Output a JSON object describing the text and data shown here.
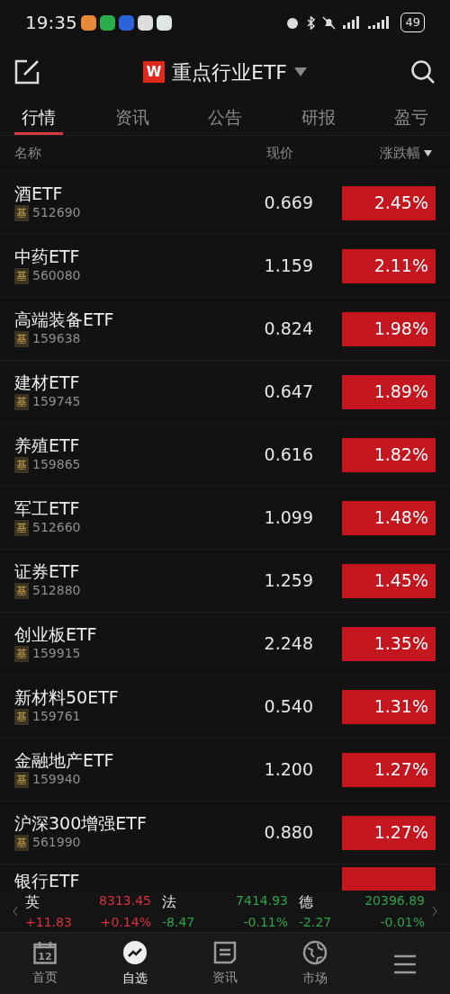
{
  "status_bar": {
    "time": "19:35",
    "battery": "49"
  },
  "header": {
    "title": "重点行业ETF",
    "logo": "W"
  },
  "tabs": [
    {
      "label": "行情",
      "selected": true
    },
    {
      "label": "资讯",
      "selected": false
    },
    {
      "label": "公告",
      "selected": false
    },
    {
      "label": "研报",
      "selected": false
    },
    {
      "label": "盈亏",
      "selected": false
    }
  ],
  "table": {
    "columns": [
      "名称",
      "现价",
      "涨跌幅"
    ],
    "rows": [
      {
        "name": "酒ETF",
        "tag": "基",
        "code": "512690",
        "price": "0.669",
        "change": "2.45%",
        "color": "#c3161f"
      },
      {
        "name": "中药ETF",
        "tag": "基",
        "code": "560080",
        "price": "1.159",
        "change": "2.11%",
        "color": "#c3161f"
      },
      {
        "name": "高端装备ETF",
        "tag": "基",
        "code": "159638",
        "price": "0.824",
        "change": "1.98%",
        "color": "#c3161f"
      },
      {
        "name": "建材ETF",
        "tag": "基",
        "code": "159745",
        "price": "0.647",
        "change": "1.89%",
        "color": "#c3161f"
      },
      {
        "name": "养殖ETF",
        "tag": "基",
        "code": "159865",
        "price": "0.616",
        "change": "1.82%",
        "color": "#c3161f"
      },
      {
        "name": "军工ETF",
        "tag": "基",
        "code": "512660",
        "price": "1.099",
        "change": "1.48%",
        "color": "#c3161f"
      },
      {
        "name": "证券ETF",
        "tag": "基",
        "code": "512880",
        "price": "1.259",
        "change": "1.45%",
        "color": "#c3161f"
      },
      {
        "name": "创业板ETF",
        "tag": "基",
        "code": "159915",
        "price": "2.248",
        "change": "1.35%",
        "color": "#c3161f"
      },
      {
        "name": "新材料50ETF",
        "tag": "基",
        "code": "159761",
        "price": "0.540",
        "change": "1.31%",
        "color": "#c3161f"
      },
      {
        "name": "金融地产ETF",
        "tag": "基",
        "code": "159940",
        "price": "1.200",
        "change": "1.27%",
        "color": "#c3161f"
      },
      {
        "name": "沪深300增强ETF",
        "tag": "基",
        "code": "561990",
        "price": "0.880",
        "change": "1.27%",
        "color": "#c3161f"
      },
      {
        "name": "银行ETF",
        "color": "#c3161f",
        "partial": true
      }
    ]
  },
  "ticker": [
    {
      "name": "英",
      "price": "8313.45",
      "change": "+11.83",
      "pct": "+0.14%",
      "color": "#d8323a"
    },
    {
      "name": "法",
      "price": "7414.93",
      "change": "-8.47",
      "pct": "-0.11%",
      "color": "#2fa24a"
    },
    {
      "name": "德",
      "price": "20396.89",
      "change": "-2.27",
      "pct": "-0.01%",
      "color": "#2fa24a"
    }
  ],
  "nav": [
    {
      "label": "首页",
      "kind": "calendar",
      "icon_text": "12",
      "selected": false
    },
    {
      "label": "自选",
      "kind": "trend",
      "selected": true
    },
    {
      "label": "资讯",
      "kind": "doc",
      "selected": false
    },
    {
      "label": "市场",
      "kind": "globe",
      "selected": false
    },
    {
      "kind": "menu",
      "selected": false
    }
  ]
}
